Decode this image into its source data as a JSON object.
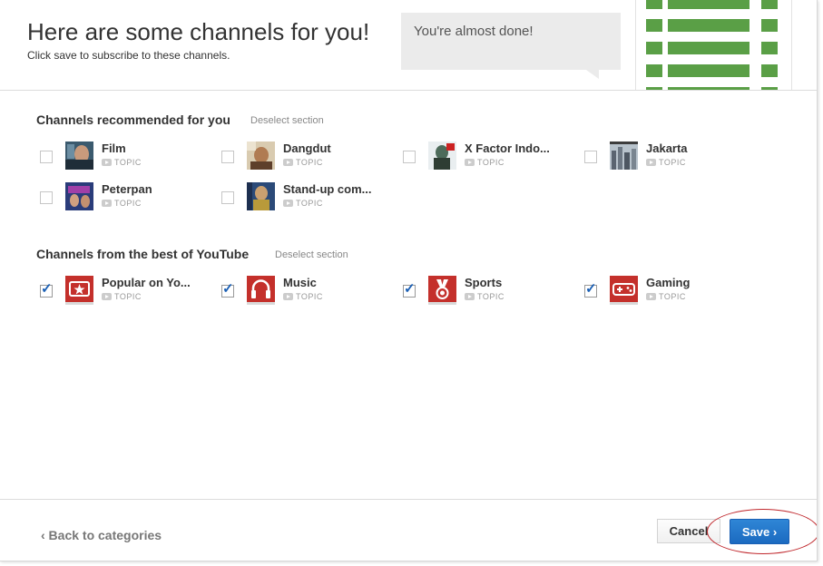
{
  "header": {
    "title": "Here are some channels for you!",
    "subtitle": "Click save to subscribe to these channels.",
    "bubble_text": "You're almost done!"
  },
  "sections": [
    {
      "title": "Channels recommended for you",
      "deselect_label": "Deselect section",
      "items": [
        {
          "name": "Film",
          "topic": "TOPIC",
          "checked": false,
          "thumb": "photo-face"
        },
        {
          "name": "Dangdut",
          "topic": "TOPIC",
          "checked": false,
          "thumb": "photo-singer"
        },
        {
          "name": "X Factor Indo...",
          "topic": "TOPIC",
          "checked": false,
          "thumb": "photo-person"
        },
        {
          "name": "Jakarta",
          "topic": "TOPIC",
          "checked": false,
          "thumb": "photo-city"
        },
        {
          "name": "Peterpan",
          "topic": "TOPIC",
          "checked": false,
          "thumb": "photo-band"
        },
        {
          "name": "Stand-up com...",
          "topic": "TOPIC",
          "checked": false,
          "thumb": "photo-comedian"
        }
      ]
    },
    {
      "title": "Channels from the best of YouTube",
      "deselect_label": "Deselect section",
      "items": [
        {
          "name": "Popular on Yo...",
          "topic": "TOPIC",
          "checked": true,
          "thumb": "star-icon"
        },
        {
          "name": "Music",
          "topic": "TOPIC",
          "checked": true,
          "thumb": "headphones-icon"
        },
        {
          "name": "Sports",
          "topic": "TOPIC",
          "checked": true,
          "thumb": "medal-icon"
        },
        {
          "name": "Gaming",
          "topic": "TOPIC",
          "checked": true,
          "thumb": "gamepad-icon"
        }
      ]
    }
  ],
  "footer": {
    "back_label": "‹ Back to categories",
    "cancel_label": "Cancel",
    "save_label": "Save ›"
  },
  "colors": {
    "progress_green": "#5a9f46",
    "youtube_red": "#c4302b",
    "save_blue": "#1b6ac0",
    "annotation_red": "#c0282d"
  }
}
